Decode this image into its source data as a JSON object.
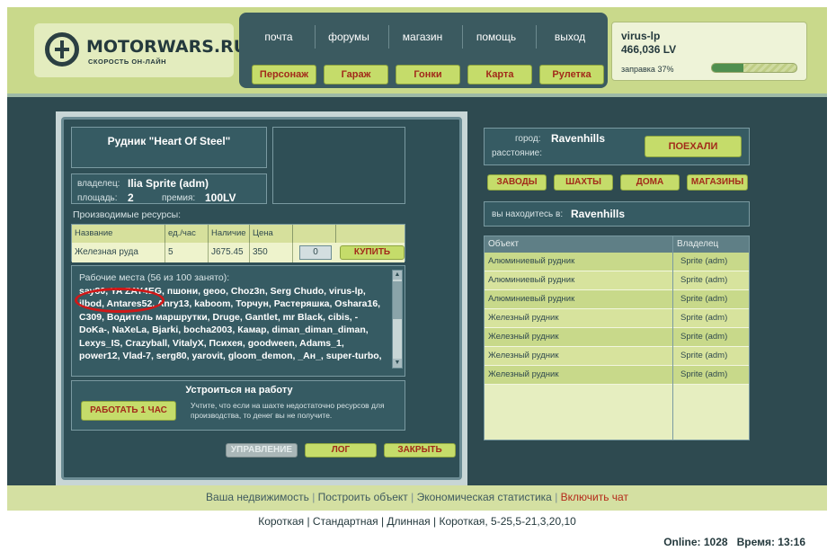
{
  "header": {
    "logo_title": "MOTORWARS.RU",
    "logo_subtitle": "СКОРОСТЬ ОН-ЛАЙН",
    "top_nav": [
      "почта",
      "форумы",
      "магазин",
      "помощь",
      "выход"
    ],
    "main_nav": [
      "Персонаж",
      "Гараж",
      "Гонки",
      "Карта",
      "Рулетка"
    ],
    "user": {
      "name": "virus-lp",
      "money": "466,036 LV",
      "fuel_label": "заправка 37%",
      "fuel_percent": 37
    }
  },
  "mine": {
    "title": "Рудник \"Heart Of Steel\"",
    "owner_label": "владелец:",
    "owner_value": "Ilia Sprite (adm)",
    "area_label": "площадь:",
    "area_value": "2",
    "bonus_label": "премия:",
    "bonus_value": "100LV",
    "resources_heading": "Производимые ресурсы:",
    "resource_columns": [
      "Название",
      "ед./час",
      "Наличие",
      "Цена"
    ],
    "resource_row": {
      "name": "Железная руда",
      "rate": "5",
      "stock": "J675.45",
      "price": "350",
      "qty": "0"
    },
    "buy_label": "КУПИТЬ",
    "workers_heading": "Рабочие места (56 из 100 занято):",
    "workers_text": "say80, YA ZAY4EG, пшони, geoo, Choz3n, Serg Chudo, virus-lp, ilbod, Antares52, Anry13, kaboom, Торчун, Растеряшка, Oshara16, C309, Водитель маршрутки, Druge, Gantlet, mr Black, cibis, -DoKa-, NaXeLa, Bjarki, bocha2003, Камар, diman_diman_diman, Lexys_IS, Crazyball, VitalyX, Психея, goodween, Adams_1, power12, Vlad-7, serg80, yarovit, gloom_demon, _Ан_, super-turbo,",
    "job_title": "Устроиться на работу",
    "job_button": "РАБОТАТЬ 1 ЧАС",
    "job_note": "Учтите, что если на шахте недостаточно ресурсов для производства, то денег вы не получите.",
    "bottom_buttons": {
      "manage": "УПРАВЛЕНИЕ",
      "log": "ЛОГ",
      "close": "ЗАКРЫТЬ"
    }
  },
  "travel": {
    "city_label": "город:",
    "city_value": "Ravenhills",
    "distance_label": "расстояние:",
    "go_button": "ПОЕХАЛИ",
    "filters": [
      "ЗАВОДЫ",
      "ШАХТЫ",
      "ДОМА",
      "МАГАЗИНЫ"
    ],
    "location_label": "вы находитесь в:",
    "location_value": "Ravenhills",
    "table_columns": [
      "Объект",
      "Владелец"
    ],
    "rows": [
      {
        "object": "Алюминиевый рудник",
        "owner": "Sprite (adm)"
      },
      {
        "object": "Алюминиевый рудник",
        "owner": "Sprite (adm)"
      },
      {
        "object": "Алюминиевый рудник",
        "owner": "Sprite (adm)"
      },
      {
        "object": "Железный рудник",
        "owner": "Sprite (adm)"
      },
      {
        "object": "Железный рудник",
        "owner": "Sprite (adm)"
      },
      {
        "object": "Железный рудник",
        "owner": "Sprite (adm)"
      },
      {
        "object": "Железный рудник",
        "owner": "Sprite (adm)"
      }
    ]
  },
  "footer": {
    "links": [
      "Ваша недвижимость",
      "Построить объект",
      "Экономическая статистика",
      "Включить чат"
    ],
    "speeds": "Короткая | Стандартная | Длинная | Короткая, 5-25,5-21,3,20,10",
    "online": "Online: 1028",
    "time": "Время: 13:16"
  },
  "colors": {
    "accent_green": "#c5dc6a",
    "panel_teal": "#365b63",
    "link_red": "#b52a1a"
  }
}
